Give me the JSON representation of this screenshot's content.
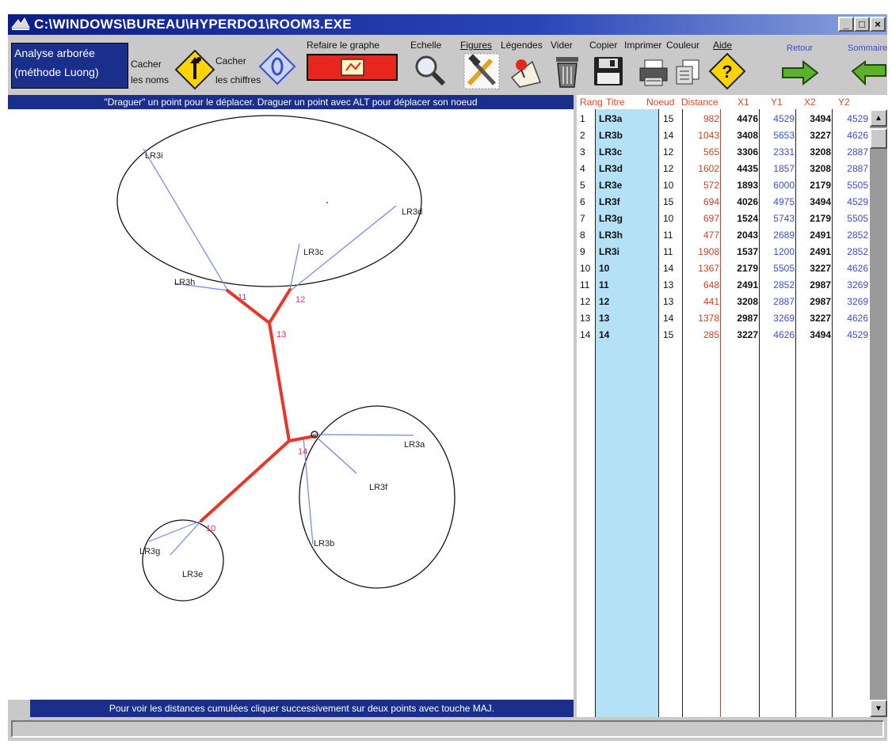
{
  "window": {
    "title": "C:\\WINDOWS\\BUREAU\\HYPERDO1\\ROOM3.EXE",
    "minimize_label": "_",
    "maximize_label": "□",
    "close_label": "×"
  },
  "toolbar": {
    "analyse_line1": "Analyse arborée",
    "analyse_line2": "(méthode Luong)",
    "cacher_noms_1": "Cacher",
    "cacher_noms_2": "les noms",
    "cacher_chiffres_1": "Cacher",
    "cacher_chiffres_2": "les chiffres",
    "refaire": "Refaire le graphe",
    "echelle": "Echelle",
    "figures": "Figures",
    "legendes": "Légendes",
    "vider": "Vider",
    "copier": "Copier",
    "imprimer": "Imprimer",
    "couleur": "Couleur",
    "aide": "Aide",
    "retour": "Retour",
    "sommaire": "Sommaire"
  },
  "hints": {
    "top": "\"Draguer\" un point pour le déplacer. Draguer un point avec ALT pour déplacer son noeud",
    "bottom": "Pour voir les distances cumulées cliquer successivement sur deux points avec touche MAJ."
  },
  "colors": {
    "highlight_edge": "#e8372a",
    "leaf_edge": "#6f86e0",
    "node_label": "#e0306a",
    "title_blue": "#1a2f8c",
    "titre_column_bg": "#b5e1f7",
    "distance_color": "#c4442a",
    "y_color": "#3b4fc4"
  },
  "graph": {
    "leaf_labels": {
      "LR3a": "LR3a",
      "LR3b": "LR3b",
      "LR3c": "LR3c",
      "LR3d": "LR3d",
      "LR3e": "LR3e",
      "LR3f": "LR3f",
      "LR3g": "LR3g",
      "LR3h": "LR3h",
      "LR3i": "LR3i"
    },
    "node_labels": {
      "n10": "10",
      "n11": "11",
      "n12": "12",
      "n13": "13",
      "n14": "14"
    }
  },
  "table": {
    "headers": [
      "Rang",
      "Titre",
      "Noeud",
      "Distance",
      "X1",
      "Y1",
      "X2",
      "Y2"
    ],
    "rows": [
      [
        "1",
        "LR3a",
        "15",
        "982",
        "4476",
        "4529",
        "3494",
        "4529"
      ],
      [
        "2",
        "LR3b",
        "14",
        "1043",
        "3408",
        "5653",
        "3227",
        "4626"
      ],
      [
        "3",
        "LR3c",
        "12",
        "565",
        "3306",
        "2331",
        "3208",
        "2887"
      ],
      [
        "4",
        "LR3d",
        "12",
        "1602",
        "4435",
        "1857",
        "3208",
        "2887"
      ],
      [
        "5",
        "LR3e",
        "10",
        "572",
        "1893",
        "6000",
        "2179",
        "5505"
      ],
      [
        "6",
        "LR3f",
        "15",
        "694",
        "4026",
        "4975",
        "3494",
        "4529"
      ],
      [
        "7",
        "LR3g",
        "10",
        "697",
        "1524",
        "5743",
        "2179",
        "5505"
      ],
      [
        "8",
        "LR3h",
        "11",
        "477",
        "2043",
        "2689",
        "2491",
        "2852"
      ],
      [
        "9",
        "LR3i",
        "11",
        "1908",
        "1537",
        "1200",
        "2491",
        "2852"
      ],
      [
        "10",
        "10",
        "14",
        "1367",
        "2179",
        "5505",
        "3227",
        "4626"
      ],
      [
        "11",
        "11",
        "13",
        "648",
        "2491",
        "2852",
        "2987",
        "3269"
      ],
      [
        "12",
        "12",
        "13",
        "441",
        "3208",
        "2887",
        "2987",
        "3269"
      ],
      [
        "13",
        "13",
        "14",
        "1378",
        "2987",
        "3269",
        "3227",
        "4626"
      ],
      [
        "14",
        "14",
        "15",
        "285",
        "3227",
        "4626",
        "3494",
        "4529"
      ]
    ]
  }
}
